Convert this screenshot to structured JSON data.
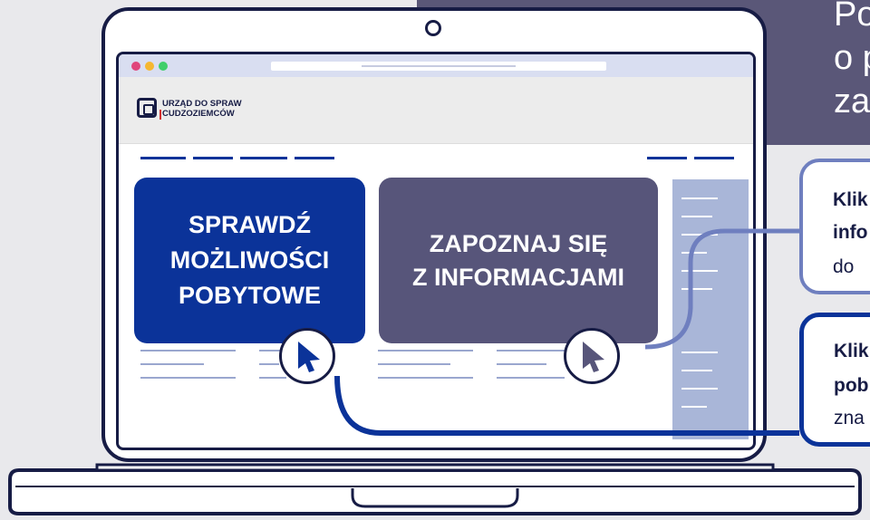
{
  "banner": {
    "line1": "Po",
    "line2": "o p",
    "line3": "za"
  },
  "site": {
    "logo_line1": "URZĄD DO SPRAW",
    "logo_line2": "CUDZOZIEMCÓW"
  },
  "cards": {
    "primary": {
      "line1": "SPRAWDŹ",
      "line2": "MOŻLIWOŚCI",
      "line3": "POBYTOWE"
    },
    "secondary": {
      "line1": "ZAPOZNAJ SIĘ",
      "line2": "Z INFORMACJAMI"
    }
  },
  "callouts": {
    "info": {
      "bold1": "Klik",
      "bold2": "info",
      "normal": "do"
    },
    "stay": {
      "bold1": "Klik",
      "bold2": "pob",
      "normal": "zna"
    }
  },
  "colors": {
    "navy": "#0b3399",
    "slate": "#57557a",
    "dark_outline": "#171c45",
    "banner": "#5a5778"
  },
  "icons": [
    "camera-icon",
    "logo-icon",
    "cursor-arrow-icon"
  ]
}
